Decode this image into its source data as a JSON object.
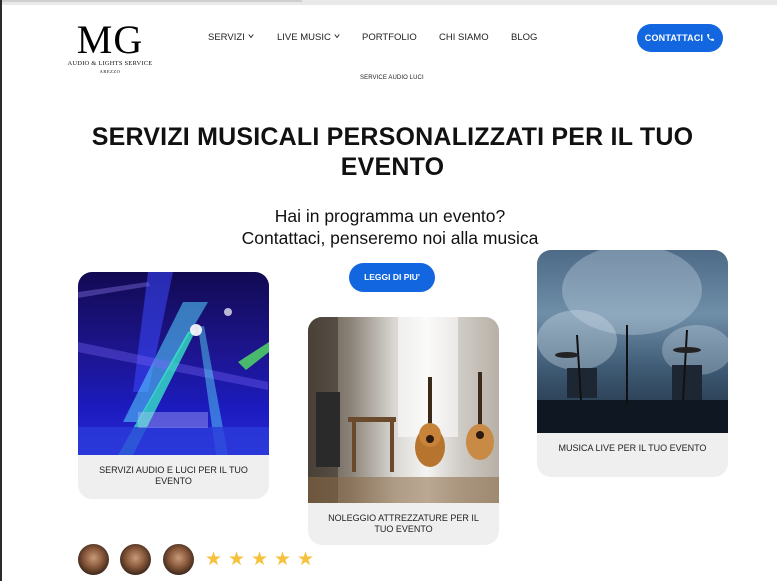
{
  "brand": {
    "logo_text": "MG",
    "subtitle": "AUDIO & LIGHTS SERVICE",
    "city": "AREZZO"
  },
  "nav": {
    "items": [
      {
        "label": "SERVIZI",
        "has_dropdown": true
      },
      {
        "label": "LIVE MUSIC",
        "has_dropdown": true
      },
      {
        "label": "PORTFOLIO",
        "has_dropdown": false
      },
      {
        "label": "CHI SIAMO",
        "has_dropdown": false
      },
      {
        "label": "BLOG",
        "has_dropdown": false
      }
    ],
    "submenu_item": "SERVICE AUDIO LUCI",
    "contact_button": "CONTATTACI",
    "contact_icon": "phone-icon"
  },
  "hero": {
    "title": "SERVIZI MUSICALI PERSONALIZZATI PER IL TUO EVENTO",
    "subtitle_line1": "Hai in programma un evento?",
    "subtitle_line2": "Contattaci, penseremo noi alla musica",
    "cta": "LEGGI DI PIU'"
  },
  "cards": [
    {
      "caption": "SERVIZI AUDIO E LUCI PER IL TUO EVENTO",
      "image": "concert-lights-image"
    },
    {
      "caption": "NOLEGGIO ATTREZZATURE PER IL TUO EVENTO",
      "image": "guitars-room-image"
    },
    {
      "caption": "MUSICA LIVE PER IL TUO EVENTO",
      "image": "stage-microphones-image"
    }
  ],
  "reviews": {
    "avatar_count": 3,
    "rating": 5,
    "max_rating": 5
  },
  "colors": {
    "accent": "#1266e0",
    "card_bg": "#efefef",
    "star": "#f6c23e"
  }
}
